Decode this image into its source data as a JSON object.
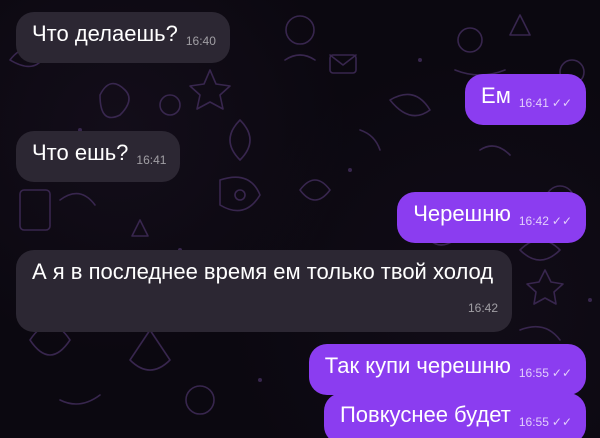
{
  "colors": {
    "background": "#0b0810",
    "incoming_bubble": "#2c2733",
    "outgoing_bubble": "#8b3df0",
    "text": "#ffffff"
  },
  "messages": [
    {
      "direction": "incoming",
      "text": "Что делаешь?",
      "time": "16:40"
    },
    {
      "direction": "outgoing",
      "text": "Ем",
      "time": "16:41",
      "status": "read-double-check-icon"
    },
    {
      "direction": "incoming",
      "text": "Что ешь?",
      "time": "16:41"
    },
    {
      "direction": "outgoing",
      "text": "Черешню",
      "time": "16:42",
      "status": "read-double-check-icon"
    },
    {
      "direction": "incoming",
      "text": "А я в последнее время ем только твой холод",
      "time": "16:42"
    },
    {
      "direction": "outgoing",
      "text": "Так купи черешню",
      "time": "16:55",
      "status": "read-double-check-icon"
    },
    {
      "direction": "outgoing",
      "text": "Повкуснее будет",
      "time": "16:55",
      "status": "read-double-check-icon"
    }
  ]
}
